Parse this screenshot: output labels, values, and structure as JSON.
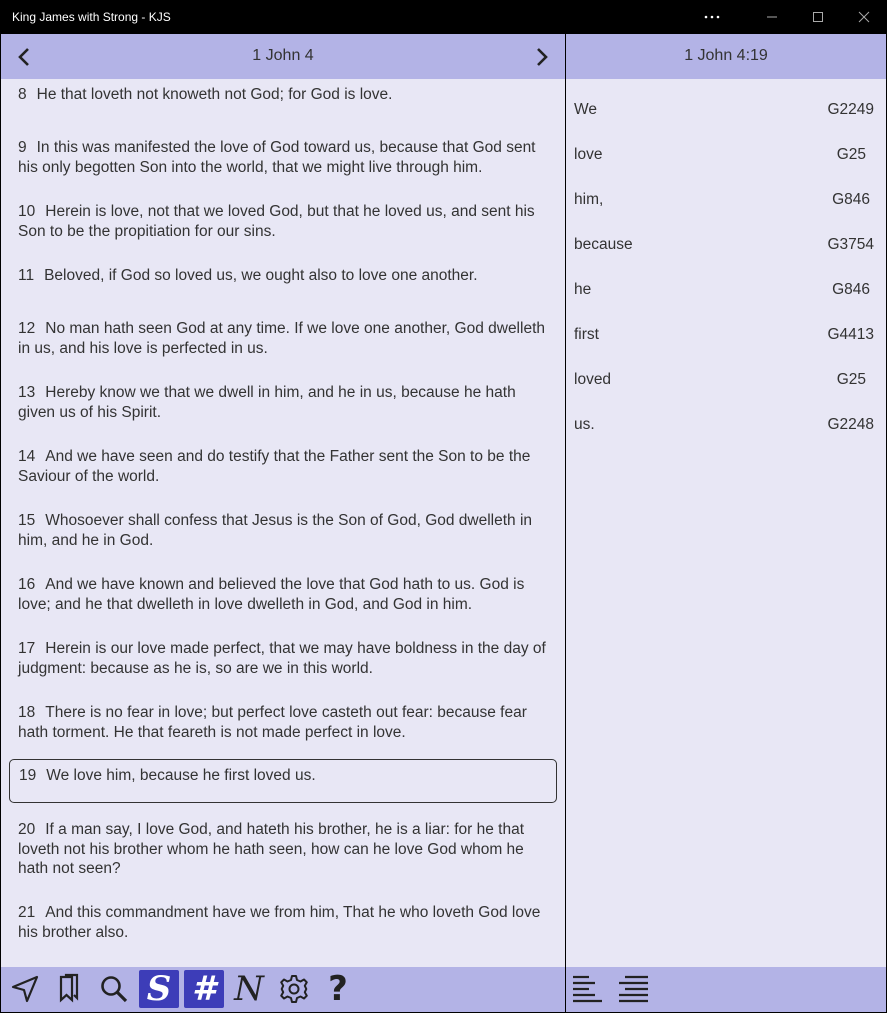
{
  "window": {
    "title": "King James with Strong - KJS",
    "more_label": "⋯"
  },
  "left": {
    "header": "1 John 4",
    "verses": [
      {
        "num": "8",
        "text": "He that loveth not knoweth not God; for God is love."
      },
      {
        "num": "9",
        "text": "In this was manifested the love of God toward us, because that God sent his only begotten Son into the world, that we might live through him."
      },
      {
        "num": "10",
        "text": "Herein is love, not that we loved God, but that he loved us, and sent his Son to be the propitiation for our sins."
      },
      {
        "num": "11",
        "text": "Beloved, if God so loved us, we ought also to love one another."
      },
      {
        "num": "12",
        "text": "No man hath seen God at any time. If we love one another, God dwelleth in us, and his love is perfected in us."
      },
      {
        "num": "13",
        "text": "Hereby know we that we dwell in him, and he in us, because he hath given us of his Spirit."
      },
      {
        "num": "14",
        "text": "And we have seen and do testify that the Father sent the Son to be the Saviour of the world."
      },
      {
        "num": "15",
        "text": "Whosoever shall confess that Jesus is the Son of God, God dwelleth in him, and he in God."
      },
      {
        "num": "16",
        "text": "And we have known and believed the love that God hath to us. God is love; and he that dwelleth in love dwelleth in God, and God in him."
      },
      {
        "num": "17",
        "text": "Herein is our love made perfect, that we may have boldness in the day of judgment: because as he is, so are we in this world."
      },
      {
        "num": "18",
        "text": "There is no fear in love; but perfect love casteth out fear: because fear hath torment. He that feareth is not made perfect in love."
      },
      {
        "num": "19",
        "text": "We love him, because he first loved us."
      },
      {
        "num": "20",
        "text": "If a man say, I love God, and hateth his brother, he is a liar: for he that loveth not his brother whom he hath seen, how can he love God whom he hath not seen?"
      },
      {
        "num": "21",
        "text": "And this commandment have we from him, That he who loveth God love his brother also."
      }
    ],
    "selected_verse": "19",
    "toolbar": {
      "strong_s_glyph": "S",
      "hash_glyph": "#",
      "n_glyph": "N",
      "help_glyph": "?"
    }
  },
  "right": {
    "header": "1 John 4:19",
    "words": [
      {
        "word": "We",
        "strong": "G2249"
      },
      {
        "word": "love",
        "strong": "G25"
      },
      {
        "word": "him,",
        "strong": "G846"
      },
      {
        "word": "because",
        "strong": "G3754"
      },
      {
        "word": "he",
        "strong": "G846"
      },
      {
        "word": "first",
        "strong": "G4413"
      },
      {
        "word": "loved",
        "strong": "G25"
      },
      {
        "word": "us.",
        "strong": "G2248"
      }
    ]
  },
  "colors": {
    "header_bg": "#b3b3e6",
    "pane_bg": "#e8e7f5",
    "active_button": "#3d3db8",
    "text": "#333333"
  },
  "icons": [
    "prev-chevron-icon",
    "next-chevron-icon",
    "navigate-icon",
    "bookmark-icon",
    "search-icon",
    "strong-s-icon",
    "strong-number-icon",
    "notes-icon",
    "gear-icon",
    "help-icon",
    "align-left-icon",
    "align-justify-icon"
  ]
}
